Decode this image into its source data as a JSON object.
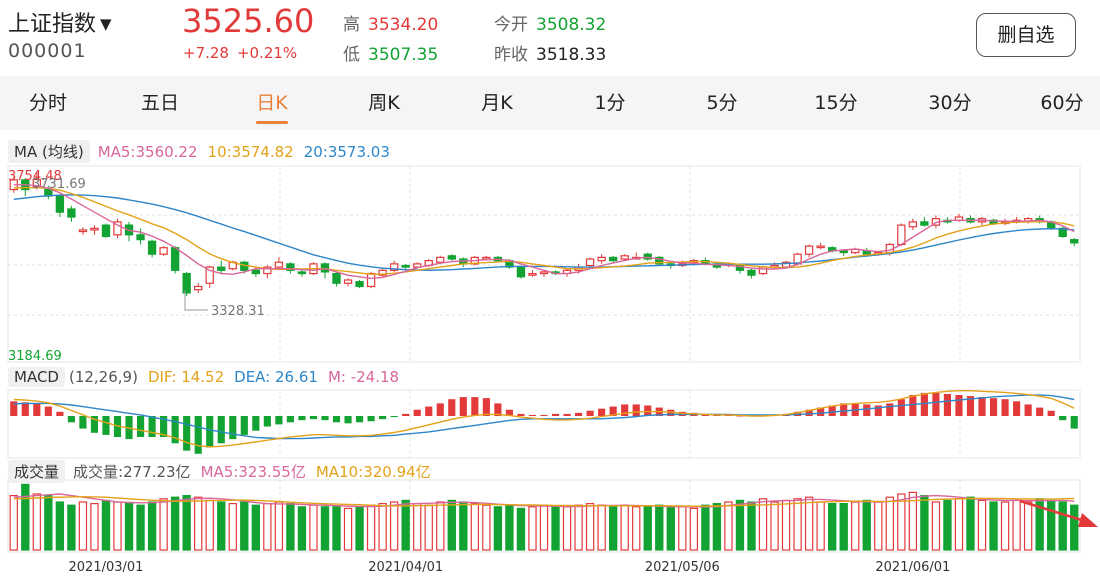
{
  "header": {
    "index_name": "上证指数",
    "index_code": "000001",
    "price": "3525.60",
    "change": "+7.28",
    "change_pct": "+0.21%",
    "high_label": "高",
    "high_value": "3534.20",
    "low_label": "低",
    "low_value": "3507.35",
    "open_label": "今开",
    "open_value": "3508.32",
    "prev_close_label": "昨收",
    "prev_close_value": "3518.33",
    "remove_watchlist_label": "删自选"
  },
  "tabs": [
    {
      "label": "分时",
      "active": false
    },
    {
      "label": "五日",
      "active": false
    },
    {
      "label": "日K",
      "active": true
    },
    {
      "label": "周K",
      "active": false
    },
    {
      "label": "月K",
      "active": false
    },
    {
      "label": "1分",
      "active": false
    },
    {
      "label": "5分",
      "active": false
    },
    {
      "label": "15分",
      "active": false
    },
    {
      "label": "30分",
      "active": false
    },
    {
      "label": "60分",
      "active": false
    }
  ],
  "ma_legend": {
    "tag": "MA (均线)",
    "ma5": "MA5:3560.22",
    "ma10": "10:3574.82",
    "ma20": "20:3573.03"
  },
  "macd_legend": {
    "tag": "MACD",
    "params": "(12,26,9)",
    "dif": "DIF: 14.52",
    "dea": "DEA: 26.61",
    "m": "M: -24.18"
  },
  "vol_legend": {
    "tag": "成交量",
    "vol": "成交量:277.23亿",
    "ma5": "MA5:323.55亿",
    "ma10": "MA10:320.94亿"
  },
  "colors": {
    "up": "#e23a3a",
    "down": "#13a332",
    "ma5": "#d9679b",
    "ma10": "#e3a21a",
    "ma20": "#2e86c9",
    "accent": "#e8813a"
  },
  "chart_data": {
    "type": "candlestick",
    "axis_labels": {
      "top": "3754.48",
      "bottom": "3184.69",
      "high_mark": "3731.69",
      "low_mark": "3328.31"
    },
    "ylim": [
      3184.69,
      3754.48
    ],
    "dates": [
      "2021/03/01",
      "2021/04/01",
      "2021/05/06",
      "2021/06/01"
    ],
    "date_index": [
      8,
      34,
      58,
      78
    ],
    "candles": [
      [
        3700,
        3730,
        3740,
        3690
      ],
      [
        3730,
        3700,
        3735,
        3680
      ],
      [
        3710,
        3731,
        3752,
        3700
      ],
      [
        3700,
        3680,
        3712,
        3670
      ],
      [
        3680,
        3630,
        3685,
        3615
      ],
      [
        3640,
        3615,
        3650,
        3600
      ],
      [
        3570,
        3575,
        3583,
        3560
      ],
      [
        3575,
        3580,
        3590,
        3560
      ],
      [
        3590,
        3555,
        3595,
        3550
      ],
      [
        3560,
        3600,
        3610,
        3550
      ],
      [
        3590,
        3560,
        3600,
        3540
      ],
      [
        3560,
        3545,
        3580,
        3530
      ],
      [
        3540,
        3500,
        3545,
        3490
      ],
      [
        3500,
        3520,
        3525,
        3495
      ],
      [
        3520,
        3450,
        3525,
        3440
      ],
      [
        3440,
        3380,
        3445,
        3370
      ],
      [
        3390,
        3400,
        3410,
        3380
      ],
      [
        3410,
        3460,
        3465,
        3395
      ],
      [
        3460,
        3450,
        3480,
        3440
      ],
      [
        3455,
        3475,
        3480,
        3450
      ],
      [
        3475,
        3450,
        3480,
        3440
      ],
      [
        3450,
        3440,
        3460,
        3430
      ],
      [
        3440,
        3460,
        3465,
        3425
      ],
      [
        3460,
        3475,
        3490,
        3455
      ],
      [
        3470,
        3450,
        3475,
        3440
      ],
      [
        3445,
        3440,
        3455,
        3430
      ],
      [
        3440,
        3470,
        3475,
        3435
      ],
      [
        3470,
        3445,
        3475,
        3425
      ],
      [
        3440,
        3410,
        3445,
        3400
      ],
      [
        3410,
        3420,
        3425,
        3400
      ],
      [
        3415,
        3400,
        3420,
        3395
      ],
      [
        3400,
        3440,
        3445,
        3395
      ],
      [
        3435,
        3450,
        3455,
        3430
      ],
      [
        3450,
        3470,
        3480,
        3445
      ],
      [
        3465,
        3460,
        3470,
        3450
      ],
      [
        3460,
        3470,
        3475,
        3455
      ],
      [
        3465,
        3480,
        3485,
        3460
      ],
      [
        3475,
        3490,
        3495,
        3470
      ],
      [
        3495,
        3485,
        3500,
        3480
      ],
      [
        3485,
        3470,
        3490,
        3460
      ],
      [
        3470,
        3490,
        3495,
        3465
      ],
      [
        3485,
        3490,
        3495,
        3480
      ],
      [
        3490,
        3480,
        3495,
        3475
      ],
      [
        3480,
        3460,
        3485,
        3455
      ],
      [
        3460,
        3430,
        3465,
        3425
      ],
      [
        3435,
        3440,
        3450,
        3430
      ],
      [
        3440,
        3445,
        3450,
        3430
      ],
      [
        3445,
        3440,
        3450,
        3435
      ],
      [
        3440,
        3450,
        3455,
        3430
      ],
      [
        3450,
        3460,
        3470,
        3440
      ],
      [
        3465,
        3485,
        3490,
        3460
      ],
      [
        3480,
        3490,
        3500,
        3470
      ],
      [
        3490,
        3480,
        3495,
        3475
      ],
      [
        3485,
        3495,
        3500,
        3480
      ],
      [
        3490,
        3490,
        3505,
        3485
      ],
      [
        3500,
        3485,
        3505,
        3480
      ],
      [
        3490,
        3470,
        3495,
        3465
      ],
      [
        3470,
        3465,
        3475,
        3455
      ],
      [
        3465,
        3470,
        3480,
        3460
      ],
      [
        3475,
        3480,
        3485,
        3470
      ],
      [
        3480,
        3470,
        3490,
        3465
      ],
      [
        3470,
        3460,
        3475,
        3455
      ],
      [
        3465,
        3470,
        3475,
        3460
      ],
      [
        3465,
        3450,
        3470,
        3440
      ],
      [
        3450,
        3435,
        3455,
        3425
      ],
      [
        3440,
        3460,
        3465,
        3435
      ],
      [
        3460,
        3465,
        3475,
        3455
      ],
      [
        3460,
        3475,
        3480,
        3455
      ],
      [
        3470,
        3500,
        3505,
        3465
      ],
      [
        3500,
        3525,
        3530,
        3490
      ],
      [
        3525,
        3525,
        3535,
        3515
      ],
      [
        3520,
        3510,
        3525,
        3505
      ],
      [
        3510,
        3505,
        3515,
        3495
      ],
      [
        3505,
        3515,
        3520,
        3500
      ],
      [
        3510,
        3500,
        3520,
        3495
      ],
      [
        3505,
        3505,
        3510,
        3495
      ],
      [
        3505,
        3530,
        3535,
        3495
      ],
      [
        3530,
        3590,
        3595,
        3525
      ],
      [
        3585,
        3600,
        3610,
        3575
      ],
      [
        3600,
        3590,
        3615,
        3585
      ],
      [
        3590,
        3610,
        3620,
        3580
      ],
      [
        3605,
        3600,
        3615,
        3595
      ],
      [
        3605,
        3615,
        3625,
        3600
      ],
      [
        3610,
        3600,
        3620,
        3595
      ],
      [
        3600,
        3610,
        3615,
        3590
      ],
      [
        3605,
        3595,
        3610,
        3590
      ],
      [
        3595,
        3600,
        3610,
        3590
      ],
      [
        3600,
        3605,
        3615,
        3595
      ],
      [
        3600,
        3610,
        3615,
        3595
      ],
      [
        3610,
        3600,
        3620,
        3595
      ],
      [
        3600,
        3580,
        3605,
        3575
      ],
      [
        3580,
        3555,
        3585,
        3550
      ],
      [
        3545,
        3535,
        3550,
        3525
      ]
    ],
    "ma5": [
      3715,
      3715,
      3712,
      3704,
      3690,
      3671,
      3650,
      3630,
      3610,
      3590,
      3574,
      3568,
      3556,
      3540,
      3520,
      3496,
      3470,
      3450,
      3440,
      3438,
      3445,
      3455,
      3455,
      3455,
      3455,
      3452,
      3450,
      3455,
      3445,
      3435,
      3430,
      3425,
      3428,
      3437,
      3447,
      3458,
      3465,
      3472,
      3477,
      3479,
      3480,
      3483,
      3484,
      3481,
      3470,
      3460,
      3450,
      3440,
      3440,
      3445,
      3455,
      3465,
      3473,
      3480,
      3488,
      3490,
      3485,
      3478,
      3473,
      3472,
      3469,
      3467,
      3465,
      3462,
      3457,
      3454,
      3454,
      3457,
      3468,
      3485,
      3500,
      3510,
      3513,
      3516,
      3511,
      3508,
      3512,
      3530,
      3553,
      3575,
      3598,
      3605,
      3605,
      3605,
      3605,
      3603,
      3602,
      3602,
      3603,
      3605,
      3600,
      3588,
      3570
    ],
    "ma10": [
      3705,
      3706,
      3706,
      3704,
      3698,
      3688,
      3676,
      3662,
      3648,
      3634,
      3622,
      3608,
      3594,
      3582,
      3565,
      3545,
      3522,
      3501,
      3486,
      3474,
      3466,
      3460,
      3455,
      3453,
      3454,
      3454,
      3455,
      3455,
      3450,
      3446,
      3442,
      3438,
      3438,
      3441,
      3445,
      3450,
      3455,
      3460,
      3465,
      3470,
      3472,
      3474,
      3476,
      3478,
      3475,
      3470,
      3465,
      3460,
      3455,
      3455,
      3456,
      3458,
      3461,
      3463,
      3467,
      3472,
      3474,
      3475,
      3476,
      3477,
      3477,
      3475,
      3472,
      3468,
      3464,
      3461,
      3459,
      3458,
      3460,
      3465,
      3472,
      3480,
      3487,
      3493,
      3497,
      3501,
      3505,
      3512,
      3522,
      3535,
      3550,
      3562,
      3572,
      3580,
      3587,
      3593,
      3597,
      3599,
      3600,
      3601,
      3600,
      3596,
      3588
    ],
    "ma20": [
      3670,
      3674,
      3678,
      3681,
      3683,
      3684,
      3683,
      3681,
      3678,
      3674,
      3668,
      3662,
      3655,
      3647,
      3638,
      3628,
      3617,
      3605,
      3593,
      3581,
      3570,
      3558,
      3546,
      3534,
      3522,
      3510,
      3498,
      3489,
      3480,
      3472,
      3466,
      3461,
      3457,
      3454,
      3452,
      3451,
      3450,
      3451,
      3452,
      3454,
      3456,
      3458,
      3460,
      3462,
      3462,
      3462,
      3462,
      3462,
      3461,
      3460,
      3460,
      3460,
      3461,
      3462,
      3463,
      3464,
      3465,
      3466,
      3467,
      3468,
      3469,
      3469,
      3469,
      3469,
      3469,
      3469,
      3470,
      3471,
      3473,
      3476,
      3479,
      3483,
      3487,
      3491,
      3494,
      3498,
      3502,
      3507,
      3513,
      3520,
      3528,
      3536,
      3544,
      3551,
      3558,
      3564,
      3569,
      3573,
      3576,
      3578,
      3579,
      3578,
      3575
    ],
    "macd_hist": [
      14,
      13,
      12,
      9,
      4,
      -6,
      -12,
      -16,
      -18,
      -20,
      -22,
      -20,
      -20,
      -20,
      -26,
      -33,
      -36,
      -30,
      -26,
      -22,
      -18,
      -14,
      -10,
      -8,
      -6,
      -4,
      -3,
      -4,
      -6,
      -7,
      -6,
      -5,
      -3,
      -1,
      2,
      6,
      9,
      12,
      16,
      18,
      18,
      17,
      12,
      6,
      2,
      1,
      1,
      2,
      2,
      3,
      5,
      7,
      9,
      11,
      11,
      10,
      8,
      6,
      4,
      3,
      2,
      2,
      1,
      0,
      0,
      0,
      1,
      2,
      4,
      6,
      8,
      10,
      12,
      12,
      11,
      10,
      12,
      16,
      20,
      22,
      22,
      21,
      20,
      19,
      18,
      17,
      16,
      14,
      11,
      8,
      5,
      -4,
      -12
    ],
    "dif": [
      30,
      29,
      27,
      24,
      18,
      10,
      2,
      -6,
      -12,
      -18,
      -22,
      -26,
      -30,
      -34,
      -40,
      -48,
      -54,
      -56,
      -55,
      -53,
      -50,
      -47,
      -44,
      -41,
      -38,
      -36,
      -34,
      -34,
      -35,
      -36,
      -36,
      -35,
      -33,
      -30,
      -26,
      -21,
      -16,
      -11,
      -6,
      -2,
      1,
      3,
      3,
      1,
      -2,
      -4,
      -6,
      -7,
      -7,
      -6,
      -4,
      -1,
      2,
      5,
      7,
      8,
      8,
      7,
      5,
      4,
      3,
      2,
      2,
      1,
      0,
      0,
      1,
      3,
      6,
      10,
      14,
      18,
      21,
      23,
      24,
      25,
      27,
      31,
      36,
      40,
      43,
      45,
      46,
      46,
      45,
      44,
      43,
      41,
      39,
      36,
      32,
      24,
      14
    ],
    "dea": [
      22,
      23,
      23,
      23,
      22,
      20,
      17,
      14,
      11,
      8,
      5,
      2,
      -2,
      -6,
      -10,
      -15,
      -20,
      -25,
      -29,
      -33,
      -36,
      -39,
      -40,
      -41,
      -41,
      -41,
      -40,
      -39,
      -38,
      -38,
      -37,
      -37,
      -36,
      -35,
      -33,
      -31,
      -29,
      -26,
      -23,
      -20,
      -17,
      -14,
      -11,
      -8,
      -6,
      -5,
      -5,
      -5,
      -5,
      -5,
      -5,
      -5,
      -4,
      -3,
      -1,
      1,
      2,
      3,
      3,
      3,
      3,
      3,
      3,
      2,
      2,
      2,
      2,
      2,
      3,
      4,
      5,
      7,
      9,
      11,
      13,
      15,
      17,
      19,
      21,
      23,
      25,
      27,
      29,
      31,
      33,
      35,
      36,
      37,
      38,
      38,
      37,
      34,
      30
    ],
    "volume": [
      340,
      410,
      350,
      340,
      300,
      280,
      300,
      290,
      310,
      300,
      290,
      280,
      300,
      320,
      330,
      340,
      330,
      310,
      300,
      290,
      300,
      280,
      290,
      300,
      290,
      270,
      280,
      270,
      270,
      260,
      270,
      280,
      290,
      300,
      310,
      290,
      280,
      300,
      310,
      300,
      290,
      280,
      270,
      280,
      260,
      270,
      280,
      270,
      270,
      280,
      290,
      280,
      270,
      280,
      270,
      270,
      280,
      270,
      270,
      260,
      280,
      290,
      300,
      310,
      300,
      320,
      300,
      310,
      320,
      330,
      300,
      290,
      290,
      300,
      310,
      300,
      330,
      350,
      360,
      340,
      300,
      310,
      320,
      330,
      310,
      300,
      300,
      310,
      300,
      320,
      310,
      300,
      280
    ],
    "vol_ma5": [
      330,
      335,
      340,
      345,
      350,
      340,
      330,
      320,
      310,
      300,
      297,
      295,
      296,
      300,
      308,
      316,
      322,
      324,
      320,
      314,
      306,
      296,
      290,
      288,
      288,
      285,
      282,
      280,
      277,
      274,
      272,
      272,
      274,
      280,
      288,
      290,
      292,
      295,
      298,
      298,
      296,
      292,
      286,
      282,
      278,
      276,
      274,
      274,
      272,
      272,
      275,
      278,
      278,
      278,
      278,
      276,
      274,
      272,
      270,
      270,
      270,
      272,
      278,
      286,
      294,
      302,
      306,
      308,
      310,
      316,
      316,
      312,
      308,
      304,
      302,
      300,
      304,
      314,
      328,
      336,
      340,
      336,
      330,
      322,
      316,
      312,
      310,
      310,
      308,
      308,
      308,
      310,
      305
    ],
    "vol_ma10": [
      320,
      322,
      325,
      328,
      330,
      332,
      333,
      332,
      330,
      325,
      320,
      315,
      311,
      308,
      305,
      305,
      306,
      308,
      310,
      311,
      312,
      310,
      307,
      303,
      299,
      295,
      292,
      289,
      287,
      285,
      283,
      280,
      277,
      276,
      276,
      277,
      278,
      280,
      282,
      284,
      285,
      285,
      284,
      283,
      282,
      281,
      280,
      279,
      278,
      277,
      276,
      276,
      276,
      276,
      276,
      276,
      276,
      276,
      275,
      274,
      274,
      275,
      276,
      278,
      280,
      282,
      285,
      288,
      292,
      296,
      300,
      302,
      304,
      305,
      305,
      304,
      304,
      305,
      308,
      312,
      316,
      318,
      320,
      322,
      323,
      322,
      321,
      320,
      319,
      318,
      318,
      320,
      321
    ]
  }
}
